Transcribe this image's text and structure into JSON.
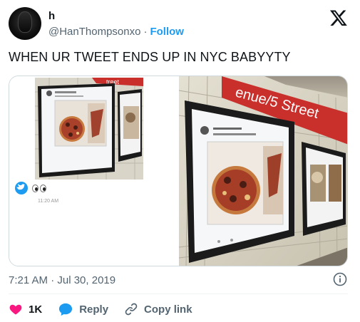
{
  "tweet": {
    "display_name": "h",
    "handle": "@HanThompsonxo",
    "separator": "·",
    "follow_label": "Follow",
    "text": "WHEN UR TWEET ENDS UP IN NYC BABYYTY",
    "timestamp": "7:21 AM · Jul 30, 2019"
  },
  "media": {
    "inset_time": "11:20 AM",
    "station_sign": "enue/5 Street",
    "left_sign": "treet"
  },
  "actions": {
    "like_count": "1K",
    "reply_label": "Reply",
    "copy_link_label": "Copy link"
  },
  "colors": {
    "accent": "#1d9bf0",
    "like": "#f91880",
    "muted": "#536471",
    "subway_red": "#c9302c"
  },
  "icons": [
    "x-logo-icon",
    "heart-icon",
    "reply-bubble-icon",
    "link-icon",
    "info-icon"
  ]
}
